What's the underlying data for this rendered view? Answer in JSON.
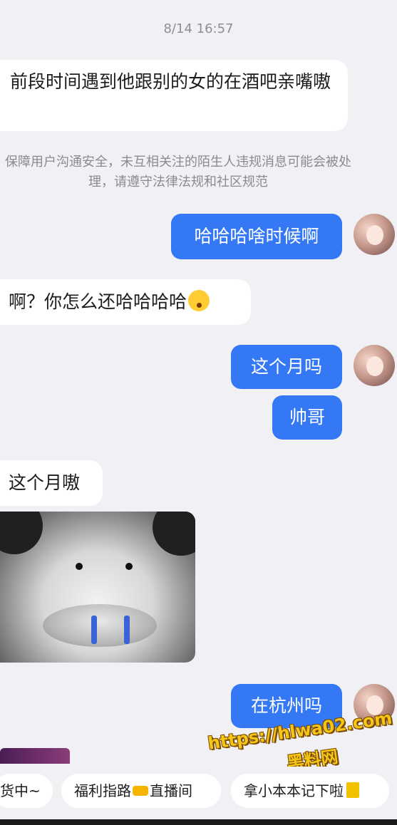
{
  "timestamp": "8/14 16:57",
  "messages": [
    {
      "side": "in",
      "text": "前段时间遇到他跟别的女的在酒吧亲嘴嗷"
    },
    {
      "side": "out",
      "text": "哈哈哈啥时候啊"
    },
    {
      "side": "in",
      "text": "啊？你怎么还哈哈哈哈"
    },
    {
      "side": "out",
      "text": "这个月吗"
    },
    {
      "side": "out",
      "text": "帅哥"
    },
    {
      "side": "in",
      "text": "这个月嗷"
    },
    {
      "side": "out",
      "text": "在杭州吗"
    }
  ],
  "safety_notice": "保障用户沟通安全，未互相关注的陌生人违规消息可能会被处理，请遵守法律法规和社区规范",
  "watermark": {
    "url": "https://hlwa02.com",
    "name": "黑料网"
  },
  "quick_replies": [
    "货中~",
    "福利指路",
    "直播间",
    "拿小本本记下啦"
  ],
  "icons": {
    "avatar": "user-avatar",
    "emoji": "shocked-face-emoji",
    "sticker": "crying-panda-sticker",
    "pointing": "pointing-hand-emoji",
    "notebook": "notebook-emoji"
  },
  "colors": {
    "outgoing_bubble": "#3478f6",
    "incoming_bubble": "#ffffff",
    "background": "#f1f0f5",
    "watermark": "#f5c518"
  }
}
